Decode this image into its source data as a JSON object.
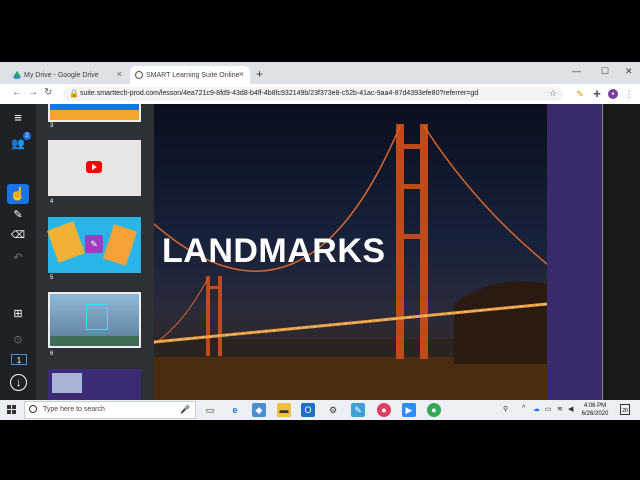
{
  "browser": {
    "tabs": [
      {
        "title": "My Drive - Google Drive",
        "active": false
      },
      {
        "title": "SMART Learning Suite Online",
        "active": true
      }
    ],
    "url": "suite.smarttech-prod.com/lesson/4ea721c9-8fd9-43d8-b4ff-4b8fc932149b/23f373e8-c52b-41ac-9aa4-87d4393efe80?referrer=gd"
  },
  "toolbar": {
    "participants_badge": "2",
    "page_indicator": "1"
  },
  "thumbnails": [
    {
      "num": "3"
    },
    {
      "num": "4"
    },
    {
      "num": "5"
    },
    {
      "num": "6"
    }
  ],
  "slide": {
    "title": "LANDMARKS"
  },
  "taskbar": {
    "search_placeholder": "Type here to search",
    "time": "4:06 PM",
    "date": "6/26/2020",
    "notifications": "20"
  },
  "colors": {
    "accent": "#1a73e8",
    "slide_purple": "#3a2a6a",
    "youtube_red": "#ff0000"
  }
}
